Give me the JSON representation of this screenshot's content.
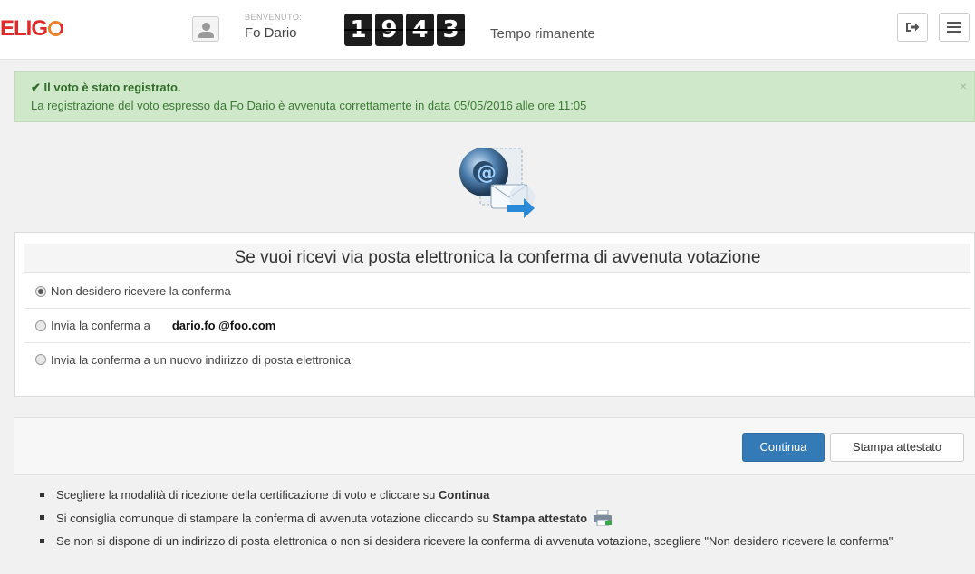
{
  "header": {
    "logo": "ELIG",
    "welcome_label": "BENVENUTO:",
    "user_name": "Fo Dario",
    "timer_digits": [
      "1",
      "9",
      "4",
      "3"
    ],
    "timer_label": "Tempo rimanente"
  },
  "alert": {
    "title": "Il voto è stato registrato.",
    "message": "La registrazione del voto espresso da Fo Dario è avvenuta correttamente in data 05/05/2016 alle ore 11:05",
    "close": "×"
  },
  "panel": {
    "heading": "Se vuoi ricevi via posta elettronica la conferma di avvenuta votazione",
    "options": [
      {
        "label": "Non desidero ricevere la conferma",
        "checked": true
      },
      {
        "label": "Invia la conferma a",
        "email": "dario.fo @foo.com",
        "checked": false
      },
      {
        "label": "Invia la conferma a un nuovo indirizzo di posta elettronica",
        "checked": false
      }
    ]
  },
  "actions": {
    "continue_label": "Continua",
    "print_label": "Stampa attestato"
  },
  "instructions": {
    "item1_text": "Scegliere la modalità di ricezione della certificazione di voto e cliccare su ",
    "item1_bold": "Continua",
    "item2_text": "Si consiglia comunque di stampare la conferma di avvenuta votazione cliccando su ",
    "item2_bold": "Stampa attestato",
    "item3_text": "Se non si dispone di un indirizzo di posta elettronica o non si desidera ricevere la conferma di avvenuta votazione, scegliere \"Non desidero ricevere la conferma\""
  },
  "colors": {
    "brand_red": "#e02a2a",
    "brand_orange": "#e8832a",
    "alert_bg": "#cfe8c9",
    "primary": "#337ab7"
  }
}
